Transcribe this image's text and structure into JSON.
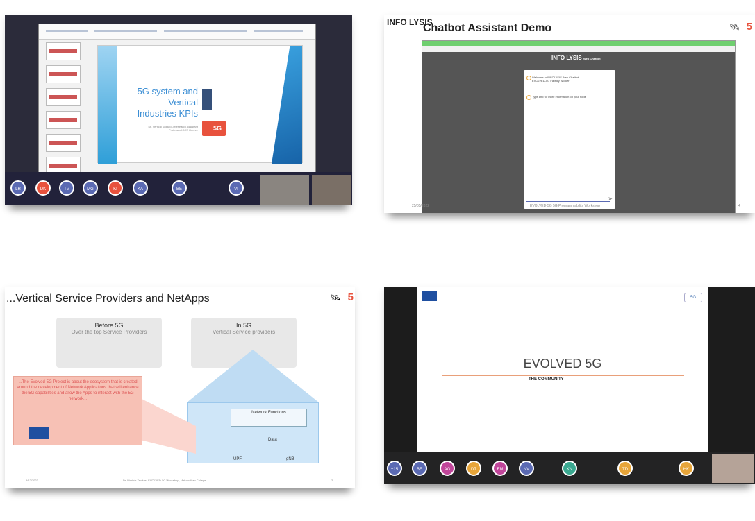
{
  "panel1": {
    "slide_title": "5G system and Vertical Industries KPIs",
    "slide_title_lines": [
      "5G system and",
      "Vertical",
      "Industries KPIs"
    ],
    "slide_subtitle": "Dr. Vertical Vassiliou Research Assistant Professor ICCS Greece",
    "badge": "5G",
    "participants": [
      "LR",
      "DK",
      "TV",
      "MG",
      "KI",
      "KA",
      "BE",
      "VI"
    ],
    "participant_colors": [
      "#5b6ab3",
      "#e8523d",
      "#5b6ab3",
      "#5b6ab3",
      "#e8523d",
      "#5b6ab3",
      "#5b6ab3",
      "#5b6ab3"
    ]
  },
  "panel2": {
    "logo": "INFO LYSIS",
    "title": "Chatbot Assistant Demo",
    "chat_logo": "INFO LYSIS",
    "chat_subtitle": "Web Chatbot",
    "messages": [
      "Welcome to INFOLYSIS Web Chatbot, EVOLVED-5G Factory Worker",
      "Type and for more information on your node"
    ],
    "footer_left": "25/05/2022",
    "footer_center": "EVOLVED-5G 5G Programmability Workshop",
    "footer_right": "4"
  },
  "panel3": {
    "title": "...Vertical Service Providers and NetApps",
    "before_title": "Before 5G",
    "before_sub": "Over the top Service Providers",
    "in_title": "In 5G",
    "in_sub": "Vertical Service providers",
    "pink_text": "...The Evolved-5G Project is about the ecosystem that is created around the development of Network Applications that will enhance the 5G capabilities and allow the Apps to interact with the 5G network...",
    "nf_label": "Network Functions",
    "data_label": "Data",
    "upf_label": "UPF",
    "gnb_label": "gNB",
    "footer_left": "5/12/2023",
    "footer_center": "Dr. Dimitris Tsolkas, EVOLVED-5G Workshop, Metropolitan College",
    "footer_right": "2"
  },
  "panel4": {
    "title": "EVOLVED 5G",
    "subtitle": "THE COMMUNITY",
    "participants": [
      "+15",
      "BE",
      "AG",
      "DT",
      "EM",
      "NV",
      "KN",
      "TD",
      "HK"
    ],
    "participant_colors": [
      "#5b6ab3",
      "#5b6ab3",
      "#c0469a",
      "#e7a53a",
      "#c0469a",
      "#5b6ab3",
      "#3aa890",
      "#e7a53a",
      "#e7a53a"
    ]
  }
}
